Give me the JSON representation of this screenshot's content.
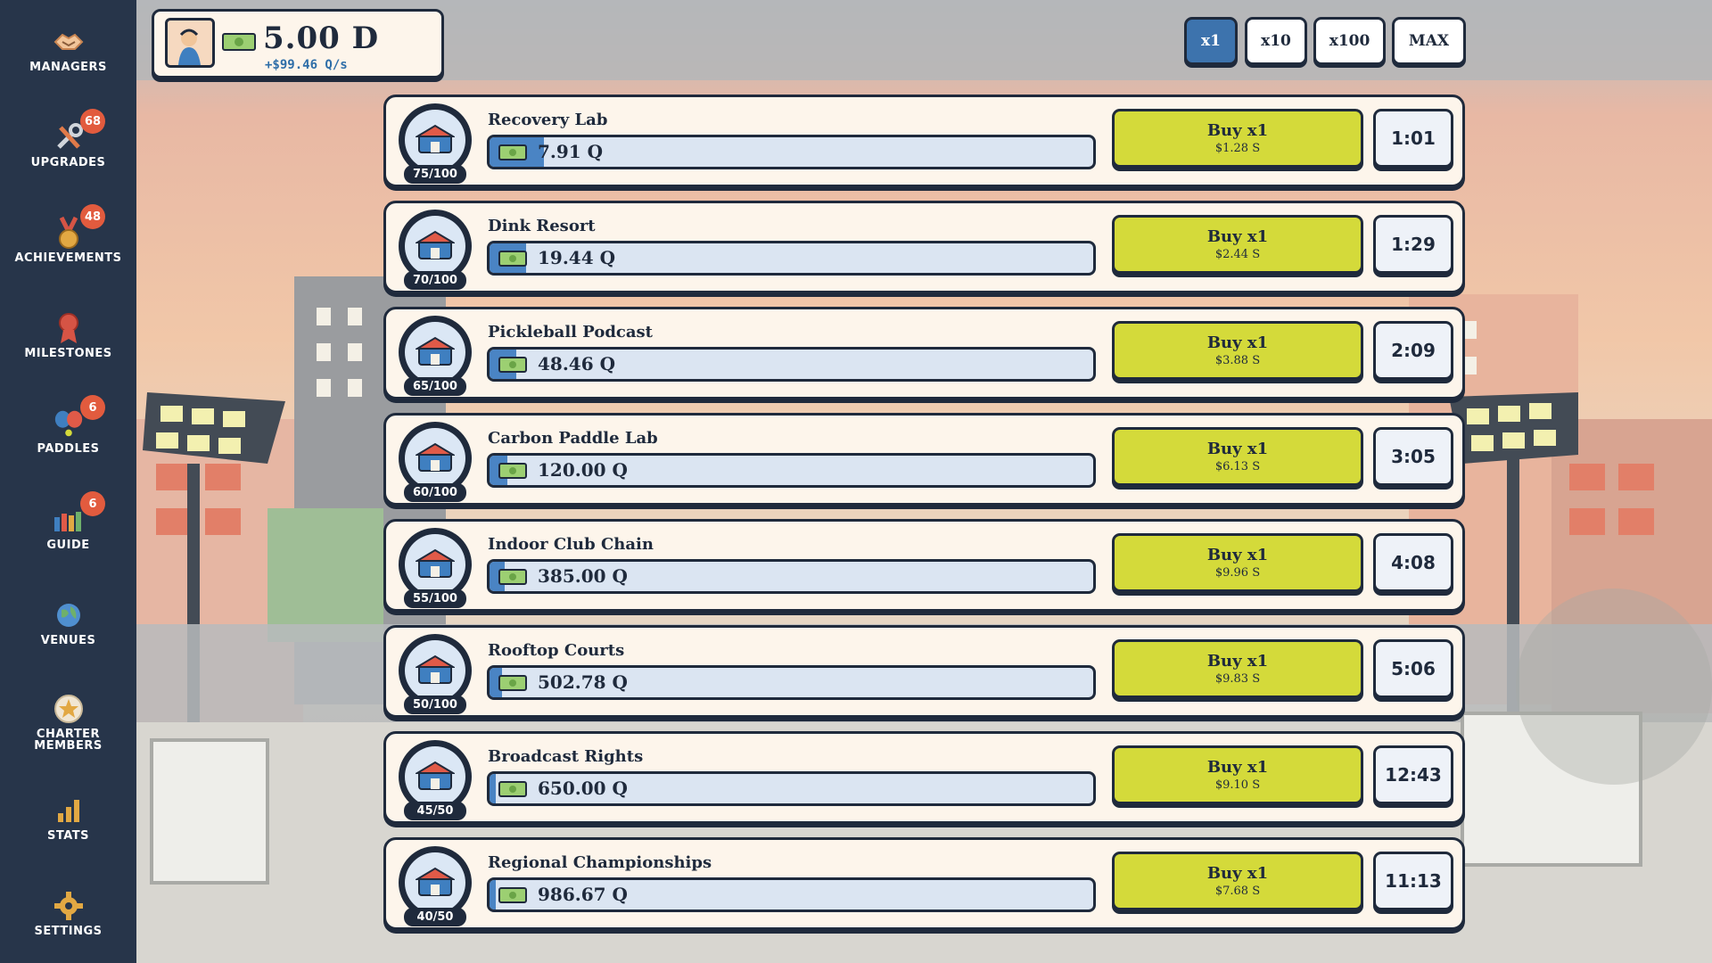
{
  "sidebar": {
    "items": [
      {
        "label": "MANAGERS",
        "icon": "handshake-icon",
        "badge": ""
      },
      {
        "label": "UPGRADES",
        "icon": "tools-icon",
        "badge": "68"
      },
      {
        "label": "ACHIEVEMENTS",
        "icon": "medal-icon",
        "badge": "48"
      },
      {
        "label": "MILESTONES",
        "icon": "ribbon-icon",
        "badge": ""
      },
      {
        "label": "PADDLES",
        "icon": "paddles-icon",
        "badge": "6"
      },
      {
        "label": "GUIDE",
        "icon": "guide-icon",
        "badge": "6"
      },
      {
        "label": "VENUES",
        "icon": "globe-icon",
        "badge": ""
      },
      {
        "label": "CHARTER\nMEMBERS",
        "icon": "star-badge-icon",
        "badge": ""
      },
      {
        "label": "STATS",
        "icon": "bar-chart-icon",
        "badge": ""
      },
      {
        "label": "SETTINGS",
        "icon": "gear-icon",
        "badge": ""
      }
    ]
  },
  "wallet": {
    "amount": "5.00 D",
    "rate": "+$99.46 Q/s"
  },
  "multipliers": {
    "options": [
      "x1",
      "x10",
      "x100",
      "MAX"
    ],
    "active": "x1"
  },
  "colors": {
    "sidebar": "#27354a",
    "outline": "#1f2a3c",
    "buy_button": "#d4da3a",
    "progress_fill": "#4a84c4",
    "badge": "#e25b3e",
    "accent_blue": "#3d73ad"
  },
  "businesses": [
    {
      "name": "Recovery Lab",
      "owned": "75/100",
      "income": "7.91 Q",
      "progress": 0.09,
      "buy_label": "Buy x1",
      "cost": "$1.28 S",
      "timer": "1:01",
      "icon": "recovery-lab-icon"
    },
    {
      "name": "Dink Resort",
      "owned": "70/100",
      "income": "19.44 Q",
      "progress": 0.06,
      "buy_label": "Buy x1",
      "cost": "$2.44 S",
      "timer": "1:29",
      "icon": "dink-resort-icon"
    },
    {
      "name": "Pickleball Podcast",
      "owned": "65/100",
      "income": "48.46 Q",
      "progress": 0.045,
      "buy_label": "Buy x1",
      "cost": "$3.88 S",
      "timer": "2:09",
      "icon": "podcast-icon"
    },
    {
      "name": "Carbon Paddle Lab",
      "owned": "60/100",
      "income": "120.00 Q",
      "progress": 0.03,
      "buy_label": "Buy x1",
      "cost": "$6.13 S",
      "timer": "3:05",
      "icon": "paddle-lab-icon"
    },
    {
      "name": "Indoor Club Chain",
      "owned": "55/100",
      "income": "385.00 Q",
      "progress": 0.025,
      "buy_label": "Buy x1",
      "cost": "$9.96 S",
      "timer": "4:08",
      "icon": "indoor-club-icon"
    },
    {
      "name": "Rooftop Courts",
      "owned": "50/100",
      "income": "502.78 Q",
      "progress": 0.02,
      "buy_label": "Buy x1",
      "cost": "$9.83 S",
      "timer": "5:06",
      "icon": "rooftop-courts-icon"
    },
    {
      "name": "Broadcast Rights",
      "owned": "45/50",
      "income": "650.00 Q",
      "progress": 0.01,
      "buy_label": "Buy x1",
      "cost": "$9.10 S",
      "timer": "12:43",
      "icon": "broadcast-icon"
    },
    {
      "name": "Regional Championships",
      "owned": "40/50",
      "income": "986.67 Q",
      "progress": 0.01,
      "buy_label": "Buy x1",
      "cost": "$7.68 S",
      "timer": "11:13",
      "icon": "championship-icon"
    }
  ]
}
